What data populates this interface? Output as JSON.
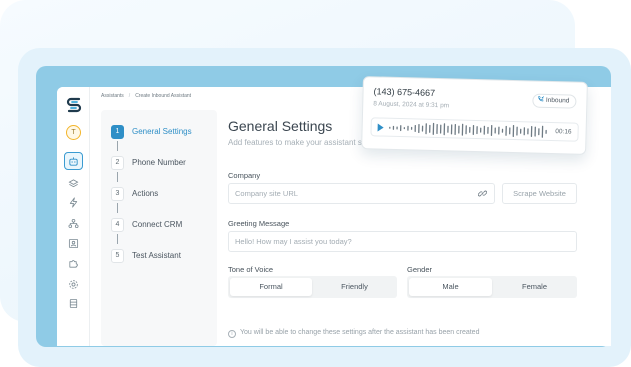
{
  "breadcrumb": {
    "root": "Assistants",
    "current": "Create Inbound Assistant"
  },
  "user": {
    "initial": "T"
  },
  "rail_icons": [
    "bot-icon",
    "layers-icon",
    "bolt-icon",
    "org-chart-icon",
    "contact-card-icon",
    "puzzle-icon",
    "settings-icon",
    "database-icon"
  ],
  "steps": [
    {
      "num": "1",
      "label": "General Settings",
      "active": true
    },
    {
      "num": "2",
      "label": "Phone Number"
    },
    {
      "num": "3",
      "label": "Actions"
    },
    {
      "num": "4",
      "label": "Connect CRM"
    },
    {
      "num": "5",
      "label": "Test Assistant"
    }
  ],
  "main": {
    "title": "General Settings",
    "subtitle": "Add features to make your assistant stand-out"
  },
  "company": {
    "label": "Company",
    "placeholder": "Company site URL",
    "scrape_label": "Scrape Website"
  },
  "greeting": {
    "label": "Greeting Message",
    "placeholder": "Hello! How may I assist you today?"
  },
  "tone": {
    "label": "Tone of Voice",
    "options": [
      "Formal",
      "Friendly"
    ],
    "selected": "Formal"
  },
  "gender": {
    "label": "Gender",
    "options": [
      "Male",
      "Female"
    ],
    "selected": "Male"
  },
  "note": "You will be able to change these settings after the assistant has been created",
  "call": {
    "number": "(143) 675-4667",
    "date": "8 August, 2024 at 9:31 pm",
    "direction": "Inbound",
    "duration": "00:16"
  },
  "colors": {
    "accent": "#2f8fc7",
    "frame": "#8fcbe6",
    "logo_dark": "#1f3a4d",
    "logo_light": "#39a7d8"
  }
}
